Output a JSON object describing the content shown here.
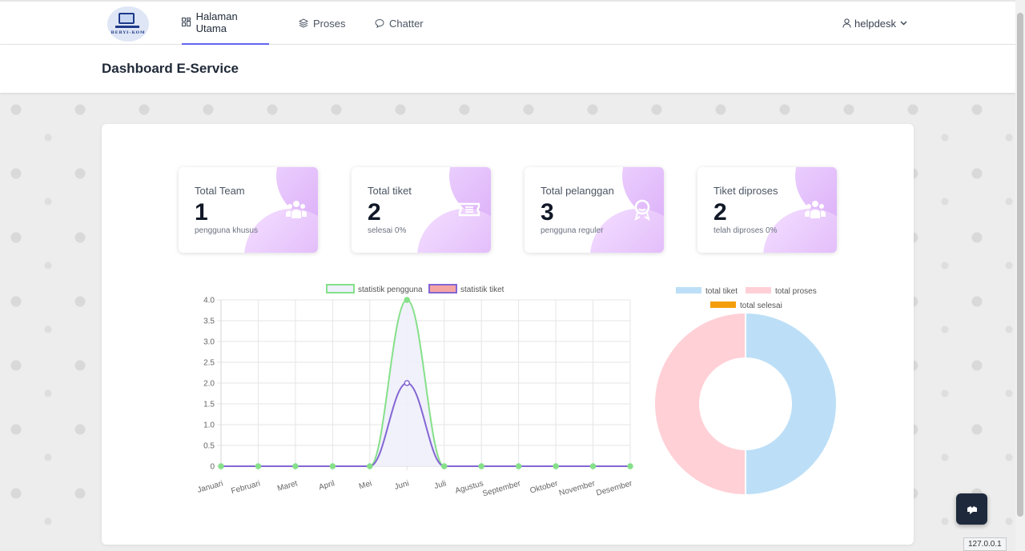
{
  "logo": {
    "text": "BERYI-KOM"
  },
  "nav": {
    "items": [
      {
        "label": "Halaman Utama",
        "icon": "dashboard-icon",
        "active": true
      },
      {
        "label": "Proses",
        "icon": "layers-icon",
        "active": false
      },
      {
        "label": "Chatter",
        "icon": "chat-icon",
        "active": false
      }
    ],
    "user": {
      "label": "helpdesk",
      "icon": "user-icon"
    }
  },
  "page": {
    "title": "Dashboard E-Service"
  },
  "stats": [
    {
      "title": "Total Team",
      "value": "1",
      "sub": "pengguna khusus",
      "icon": "team-icon"
    },
    {
      "title": "Total tiket",
      "value": "2",
      "sub": "selesai 0%",
      "icon": "ticket-icon"
    },
    {
      "title": "Total pelanggan",
      "value": "3",
      "sub": "pengguna reguler",
      "icon": "award-icon"
    },
    {
      "title": "Tiket diproses",
      "value": "2",
      "sub": "telah diproses 0%",
      "icon": "team-icon"
    }
  ],
  "colors": {
    "accent": "#6366f1",
    "card_gradient": "#d7a6f7",
    "green": "#86e08a",
    "purple": "#8466d3",
    "blue": "#bcdff7",
    "pink": "#ffd0d6",
    "orange": "#f59e0b"
  },
  "chart_data": [
    {
      "type": "line",
      "categories": [
        "Januari",
        "Februari",
        "Maret",
        "April",
        "Mei",
        "Juni",
        "Juli",
        "Agustus",
        "September",
        "Oktober",
        "November",
        "Desember"
      ],
      "series": [
        {
          "name": "statistik pengguna",
          "values": [
            0,
            0,
            0,
            0,
            0,
            4,
            0,
            0,
            0,
            0,
            0,
            0
          ],
          "color": "#86e08a",
          "fill": "#eef0fb"
        },
        {
          "name": "statistik tiket",
          "values": [
            0,
            0,
            0,
            0,
            0,
            2,
            0,
            0,
            0,
            0,
            0,
            0
          ],
          "color": "#8466d3",
          "fill": "#f6a5a5"
        }
      ],
      "ylim": [
        0,
        4
      ],
      "yticks": [
        "4.0",
        "3.5",
        "3.0",
        "2.5",
        "2.0",
        "1.5",
        "1.0",
        "0.5",
        "0"
      ],
      "grid": true,
      "legend": "top"
    },
    {
      "type": "pie",
      "style": "doughnut",
      "labels": [
        "total tiket",
        "total proses",
        "total selesai"
      ],
      "values": [
        2,
        2,
        0
      ],
      "colors": [
        "#bcdff7",
        "#ffd0d6",
        "#f59e0b"
      ],
      "legend": "top"
    }
  ],
  "footer": {
    "host": "127.0.0.1"
  }
}
